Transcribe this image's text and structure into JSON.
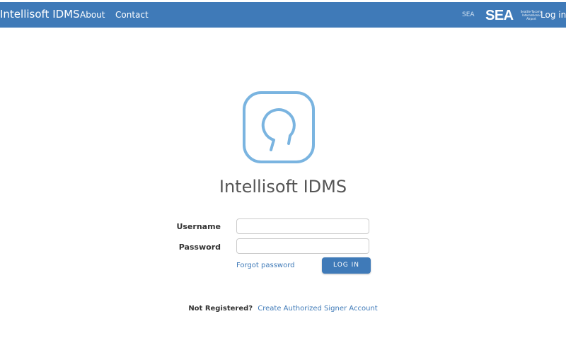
{
  "navbar": {
    "brand": "Intellisoft IDMS",
    "links": [
      {
        "label": "About"
      },
      {
        "label": "Contact"
      }
    ],
    "small_label": "SEA",
    "partner_logo": {
      "text": "SEA",
      "subtext": "Seattle-Tacoma\nInternational\nAirport"
    },
    "login_label": "Log in"
  },
  "main": {
    "icon": "intellisoft-logo-icon",
    "title": "Intellisoft IDMS",
    "form": {
      "username_label": "Username",
      "username_value": "",
      "password_label": "Password",
      "password_value": "",
      "forgot_label": "Forgot password",
      "login_button_label": "LOG IN"
    },
    "register": {
      "prompt": "Not Registered?",
      "link_label": "Create Authorized Signer Account"
    }
  },
  "colors": {
    "navbar_bg": "#3f7ab8",
    "logo_stroke": "#7ab4e0",
    "link": "#3f7ab8"
  }
}
